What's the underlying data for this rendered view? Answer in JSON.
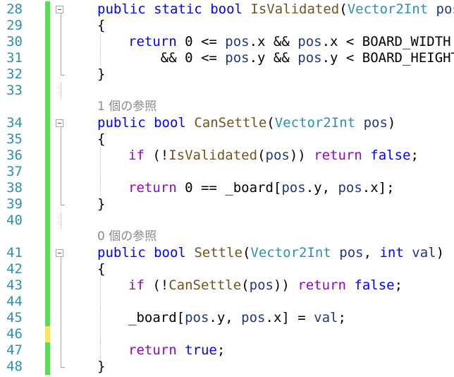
{
  "colors": {
    "line_number": "#2b91af",
    "keyword": "#0000ff",
    "type": "#2b91af",
    "identifier": "#1f377f",
    "method": "#74531f",
    "control": "#8f08c4",
    "plain": "#000000",
    "change_saved": "#5bd95b",
    "change_unsaved": "#f5e663",
    "codelens": "#8a8a8a"
  },
  "rows": [
    {
      "kind": "code",
      "num": "28",
      "change": "saved",
      "indent": 0,
      "fold": "box",
      "tokens": [
        [
          "kw",
          "public"
        ],
        [
          "pl",
          " "
        ],
        [
          "kw",
          "static"
        ],
        [
          "pl",
          " "
        ],
        [
          "kw",
          "bool"
        ],
        [
          "pl",
          " "
        ],
        [
          "mt",
          "IsValidated"
        ],
        [
          "pl",
          "("
        ],
        [
          "ty",
          "Vector2Int"
        ],
        [
          "pl",
          " "
        ],
        [
          "id",
          "pos"
        ],
        [
          "pl",
          ")"
        ]
      ]
    },
    {
      "kind": "code",
      "num": "29",
      "change": "saved",
      "indent": 0,
      "fold": "line",
      "tokens": [
        [
          "pl",
          "{"
        ]
      ]
    },
    {
      "kind": "code",
      "num": "30",
      "change": "saved",
      "indent": 1,
      "fold": "line",
      "tokens": [
        [
          "kw",
          "return"
        ],
        [
          "pl",
          " 0 <= "
        ],
        [
          "id",
          "pos"
        ],
        [
          "pl",
          ".x && "
        ],
        [
          "id",
          "pos"
        ],
        [
          "pl",
          ".x < BOARD_WIDTH"
        ]
      ]
    },
    {
      "kind": "code",
      "num": "31",
      "change": "saved",
      "indent": 1,
      "fold": "line",
      "extra": "    ",
      "tokens": [
        [
          "pl",
          "&& 0 <= "
        ],
        [
          "id",
          "pos"
        ],
        [
          "pl",
          ".y && "
        ],
        [
          "id",
          "pos"
        ],
        [
          "pl",
          ".y < BOARD_HEIGHT;"
        ]
      ]
    },
    {
      "kind": "code",
      "num": "32",
      "change": "saved",
      "indent": 0,
      "fold": "end",
      "tokens": [
        [
          "pl",
          "}"
        ]
      ]
    },
    {
      "kind": "code",
      "num": "33",
      "change": "saved",
      "indent": 0,
      "fold": "none",
      "tokens": []
    },
    {
      "kind": "lens",
      "change": "saved",
      "text": "1 個の参照"
    },
    {
      "kind": "code",
      "num": "34",
      "change": "saved",
      "indent": 0,
      "fold": "box",
      "tokens": [
        [
          "kw",
          "public"
        ],
        [
          "pl",
          " "
        ],
        [
          "kw",
          "bool"
        ],
        [
          "pl",
          " "
        ],
        [
          "mt",
          "CanSettle"
        ],
        [
          "pl",
          "("
        ],
        [
          "ty",
          "Vector2Int"
        ],
        [
          "pl",
          " "
        ],
        [
          "id",
          "pos"
        ],
        [
          "pl",
          ")"
        ]
      ]
    },
    {
      "kind": "code",
      "num": "35",
      "change": "saved",
      "indent": 0,
      "fold": "line",
      "tokens": [
        [
          "pl",
          "{"
        ]
      ]
    },
    {
      "kind": "code",
      "num": "36",
      "change": "saved",
      "indent": 1,
      "fold": "line",
      "tokens": [
        [
          "ct",
          "if"
        ],
        [
          "pl",
          " (!"
        ],
        [
          "mt",
          "IsValidated"
        ],
        [
          "pl",
          "("
        ],
        [
          "id",
          "pos"
        ],
        [
          "pl",
          ")) "
        ],
        [
          "ct",
          "return"
        ],
        [
          "pl",
          " "
        ],
        [
          "kw",
          "false"
        ],
        [
          "pl",
          ";"
        ]
      ]
    },
    {
      "kind": "code",
      "num": "37",
      "change": "saved",
      "indent": 1,
      "fold": "line",
      "tokens": []
    },
    {
      "kind": "code",
      "num": "38",
      "change": "saved",
      "indent": 1,
      "fold": "line",
      "tokens": [
        [
          "ct",
          "return"
        ],
        [
          "pl",
          " 0 == _board["
        ],
        [
          "id",
          "pos"
        ],
        [
          "pl",
          ".y, "
        ],
        [
          "id",
          "pos"
        ],
        [
          "pl",
          ".x];"
        ]
      ]
    },
    {
      "kind": "code",
      "num": "39",
      "change": "saved",
      "indent": 0,
      "fold": "end",
      "tokens": [
        [
          "pl",
          "}"
        ]
      ]
    },
    {
      "kind": "code",
      "num": "40",
      "change": "saved",
      "indent": 0,
      "fold": "none",
      "tokens": []
    },
    {
      "kind": "lens",
      "change": "saved",
      "text": "0 個の参照"
    },
    {
      "kind": "code",
      "num": "41",
      "change": "saved",
      "indent": 0,
      "fold": "box",
      "tokens": [
        [
          "kw",
          "public"
        ],
        [
          "pl",
          " "
        ],
        [
          "kw",
          "bool"
        ],
        [
          "pl",
          " "
        ],
        [
          "mt",
          "Settle"
        ],
        [
          "pl",
          "("
        ],
        [
          "ty",
          "Vector2Int"
        ],
        [
          "pl",
          " "
        ],
        [
          "id",
          "pos"
        ],
        [
          "pl",
          ", "
        ],
        [
          "kw",
          "int"
        ],
        [
          "pl",
          " "
        ],
        [
          "id",
          "val"
        ],
        [
          "pl",
          ")"
        ]
      ]
    },
    {
      "kind": "code",
      "num": "42",
      "change": "saved",
      "indent": 0,
      "fold": "line",
      "tokens": [
        [
          "pl",
          "{"
        ]
      ]
    },
    {
      "kind": "code",
      "num": "43",
      "change": "saved",
      "indent": 1,
      "fold": "line",
      "tokens": [
        [
          "ct",
          "if"
        ],
        [
          "pl",
          " (!"
        ],
        [
          "mt",
          "CanSettle"
        ],
        [
          "pl",
          "("
        ],
        [
          "id",
          "pos"
        ],
        [
          "pl",
          ")) "
        ],
        [
          "ct",
          "return"
        ],
        [
          "pl",
          " "
        ],
        [
          "kw",
          "false"
        ],
        [
          "pl",
          ";"
        ]
      ]
    },
    {
      "kind": "code",
      "num": "44",
      "change": "saved",
      "indent": 1,
      "fold": "line",
      "tokens": []
    },
    {
      "kind": "code",
      "num": "45",
      "change": "saved",
      "indent": 1,
      "fold": "line",
      "tokens": [
        [
          "pl",
          "_board["
        ],
        [
          "id",
          "pos"
        ],
        [
          "pl",
          ".y, "
        ],
        [
          "id",
          "pos"
        ],
        [
          "pl",
          ".x] = "
        ],
        [
          "id",
          "val"
        ],
        [
          "pl",
          ";"
        ]
      ]
    },
    {
      "kind": "code",
      "num": "46",
      "change": "unsaved",
      "indent": 1,
      "fold": "line",
      "tokens": []
    },
    {
      "kind": "code",
      "num": "47",
      "change": "saved",
      "indent": 1,
      "fold": "line",
      "tokens": [
        [
          "ct",
          "return"
        ],
        [
          "pl",
          " "
        ],
        [
          "kw",
          "true"
        ],
        [
          "pl",
          ";"
        ]
      ]
    },
    {
      "kind": "code",
      "num": "48",
      "change": "saved",
      "indent": 0,
      "fold": "end",
      "tokens": [
        [
          "pl",
          "}"
        ]
      ]
    }
  ]
}
